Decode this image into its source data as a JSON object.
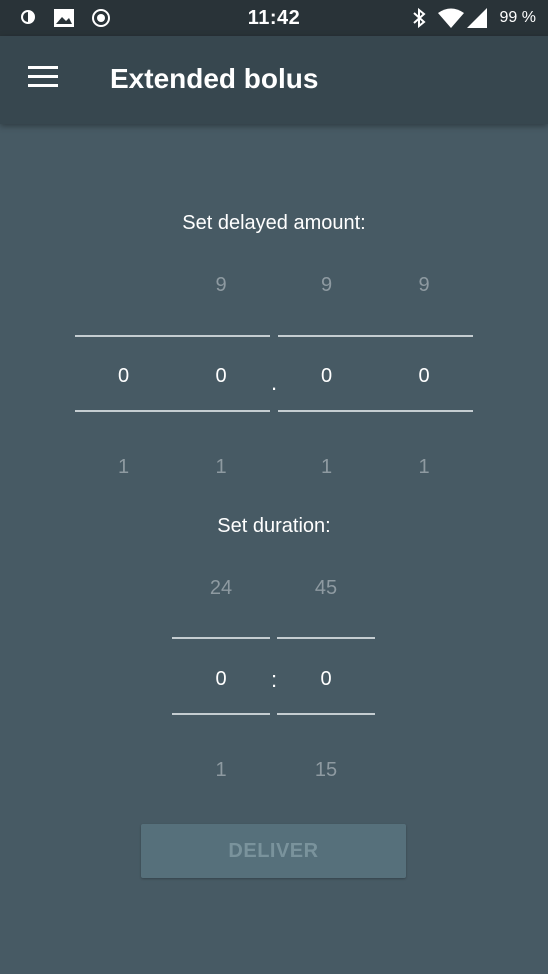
{
  "status_bar": {
    "time": "11:42",
    "battery": "99 %",
    "icons": [
      "data-saver-icon",
      "image-icon",
      "record-icon",
      "bluetooth-icon",
      "wifi-icon",
      "signal-icon"
    ]
  },
  "app_bar": {
    "title": "Extended bolus",
    "menu_icon": "hamburger-menu-icon"
  },
  "delayed_amount": {
    "label": "Set delayed amount:",
    "separator": ".",
    "columns": [
      {
        "above": "",
        "value": "0",
        "below": "1"
      },
      {
        "above": "9",
        "value": "0",
        "below": "1"
      },
      {
        "above": "9",
        "value": "0",
        "below": "1"
      },
      {
        "above": "9",
        "value": "0",
        "below": "1"
      }
    ]
  },
  "duration": {
    "label": "Set duration:",
    "separator": ":",
    "columns": [
      {
        "above": "24",
        "value": "0",
        "below": "1"
      },
      {
        "above": "45",
        "value": "0",
        "below": "15"
      }
    ]
  },
  "deliver_button": {
    "label": "DELIVER",
    "enabled": false
  },
  "colors": {
    "background": "#475a64",
    "app_bar": "#37474f",
    "status_bar": "#293338",
    "button_disabled": "#56707b"
  }
}
